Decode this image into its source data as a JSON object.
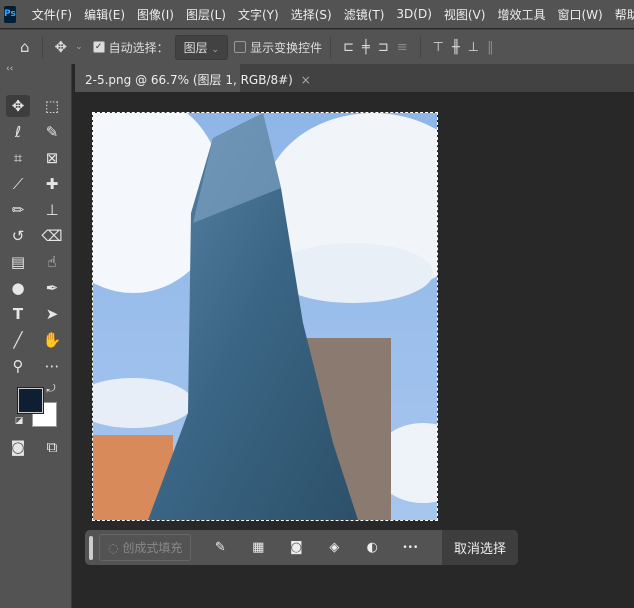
{
  "app": {
    "logo": "Ps"
  },
  "menu": [
    "文件(F)",
    "编辑(E)",
    "图像(I)",
    "图层(L)",
    "文字(Y)",
    "选择(S)",
    "滤镜(T)",
    "3D(D)",
    "视图(V)",
    "增效工具",
    "窗口(W)",
    "帮助(H)"
  ],
  "options": {
    "auto_select_label": "自动选择：",
    "auto_select_checked": true,
    "target_value": "图层",
    "show_transform_label": "显示变换控件",
    "show_transform_checked": false
  },
  "tab": {
    "title": "2-5.png @ 66.7% (图层 1, RGB/8#)",
    "close": "×"
  },
  "toolbar": {
    "collapse": "‹‹",
    "foreground_color": "#0f1f33",
    "background_color": "#ffffff"
  },
  "context_bar": {
    "generative_fill": "创成式填充",
    "more": "•••",
    "deselect": "取消选择"
  }
}
